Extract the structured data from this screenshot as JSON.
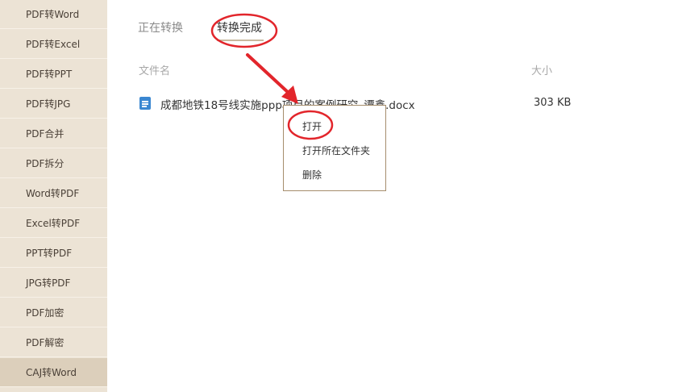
{
  "sidebar": {
    "items": [
      {
        "label": "PDF转Word"
      },
      {
        "label": "PDF转Excel"
      },
      {
        "label": "PDF转PPT"
      },
      {
        "label": "PDF转JPG"
      },
      {
        "label": "PDF合并"
      },
      {
        "label": "PDF拆分"
      },
      {
        "label": "Word转PDF"
      },
      {
        "label": "Excel转PDF"
      },
      {
        "label": "PPT转PDF"
      },
      {
        "label": "JPG转PDF"
      },
      {
        "label": "PDF加密"
      },
      {
        "label": "PDF解密"
      },
      {
        "label": "CAJ转Word"
      }
    ],
    "active_index": 12
  },
  "tabs": {
    "in_progress": "正在转换",
    "completed": "转换完成"
  },
  "table": {
    "headers": {
      "name": "文件名",
      "size": "大小"
    },
    "rows": [
      {
        "name": "成都地铁18号线实施ppp项目的案例研究_谭鑫.docx",
        "size": "303 KB",
        "icon": "docx-file-icon"
      }
    ]
  },
  "context_menu": {
    "items": {
      "open": "打开",
      "open_folder": "打开所在文件夹",
      "delete": "删除"
    }
  },
  "colors": {
    "sidebar_bg": "#ece3d5",
    "sidebar_active_bg": "#dccfbb",
    "accent_border": "#a58d6c",
    "file_icon": "#3a87d1",
    "annotation_red": "#e2252b"
  }
}
